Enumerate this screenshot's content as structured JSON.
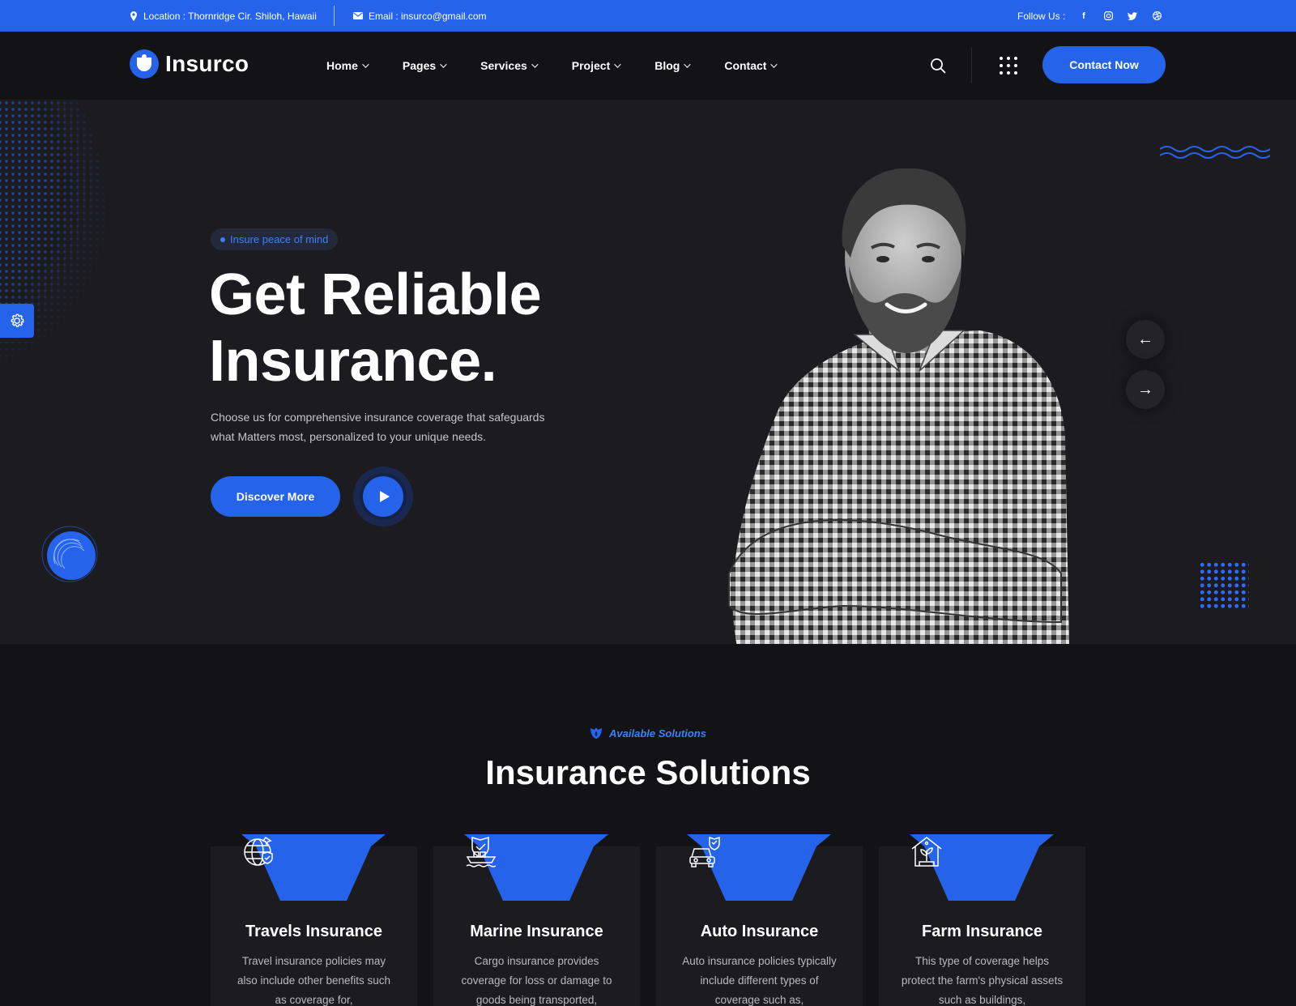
{
  "topbar": {
    "location": "Location : Thornridge Cir. Shiloh, Hawaii",
    "email": "Email : insurco@gmail.com",
    "follow_label": "Follow Us :",
    "socials": [
      "facebook-icon",
      "instagram-icon",
      "twitter-icon",
      "dribbble-icon"
    ]
  },
  "header": {
    "logo_text": "Insurco",
    "nav": [
      {
        "label": "Home"
      },
      {
        "label": "Pages"
      },
      {
        "label": "Services"
      },
      {
        "label": "Project"
      },
      {
        "label": "Blog"
      },
      {
        "label": "Contact"
      }
    ],
    "cta_label": "Contact Now"
  },
  "hero": {
    "badge": "Insure peace of mind",
    "title_line1": "Get Reliable",
    "title_line2": "Insurance.",
    "description": "Choose us for comprehensive insurance coverage that safeguards what Matters most, personalized to your unique needs.",
    "discover_label": "Discover More",
    "prev_arrow": "←",
    "next_arrow": "→"
  },
  "solutions": {
    "eyebrow": "Available Solutions",
    "title": "Insurance Solutions",
    "cards": [
      {
        "title": "Travels Insurance",
        "text": "Travel insurance policies may also include other benefits such as coverage for,",
        "icon": "globe-shield-icon"
      },
      {
        "title": "Marine Insurance",
        "text": "Cargo insurance provides coverage for loss or damage to goods being transported,",
        "icon": "ship-shield-icon"
      },
      {
        "title": "Auto Insurance",
        "text": "Auto insurance policies typically include different types of coverage such as,",
        "icon": "car-shield-icon"
      },
      {
        "title": "Farm Insurance",
        "text": "This type of coverage helps protect the farm's physical assets such as buildings,",
        "icon": "farm-house-icon"
      }
    ]
  },
  "colors": {
    "accent": "#2563eb",
    "background": "#131315",
    "hero_background": "#1c1c20"
  }
}
